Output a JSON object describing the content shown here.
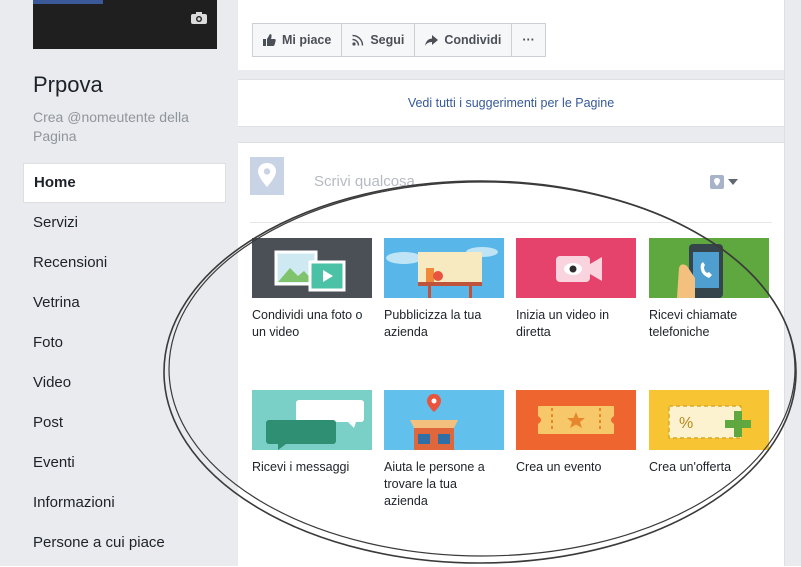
{
  "page": {
    "name": "Prpova",
    "username_prompt": "Crea @nomeutente della Pagina"
  },
  "nav": [
    {
      "label": "Home",
      "active": true
    },
    {
      "label": "Servizi"
    },
    {
      "label": "Recensioni"
    },
    {
      "label": "Vetrina"
    },
    {
      "label": "Foto"
    },
    {
      "label": "Video"
    },
    {
      "label": "Post"
    },
    {
      "label": "Eventi"
    },
    {
      "label": "Informazioni"
    },
    {
      "label": "Persone a cui piace"
    }
  ],
  "actions": {
    "like": "Mi piace",
    "follow": "Segui",
    "share": "Condividi",
    "more": "···"
  },
  "suggestions_link": "Vedi tutti i suggerimenti per le Pagine",
  "composer": {
    "placeholder": "Scrivi qualcosa..."
  },
  "tiles": [
    {
      "label": "Condividi una foto o un video",
      "bg": "#4b4f56"
    },
    {
      "label": "Pubblicizza la tua azienda",
      "bg": "#58b6e8"
    },
    {
      "label": "Inizia un video in diretta",
      "bg": "#e5436b"
    },
    {
      "label": "Ricevi chiamate telefoniche",
      "bg": "#5fa83f"
    },
    {
      "label": "Ricevi i messaggi",
      "bg": "#7ad0c7"
    },
    {
      "label": "Aiuta le persone a trovare la tua azienda",
      "bg": "#61c0ec"
    },
    {
      "label": "Crea un evento",
      "bg": "#ef6530"
    },
    {
      "label": "Crea un'offerta",
      "bg": "#f7c434"
    }
  ],
  "colors": {
    "link": "#365899",
    "background": "#e9ebee",
    "annotation": "#3a3a3a"
  }
}
